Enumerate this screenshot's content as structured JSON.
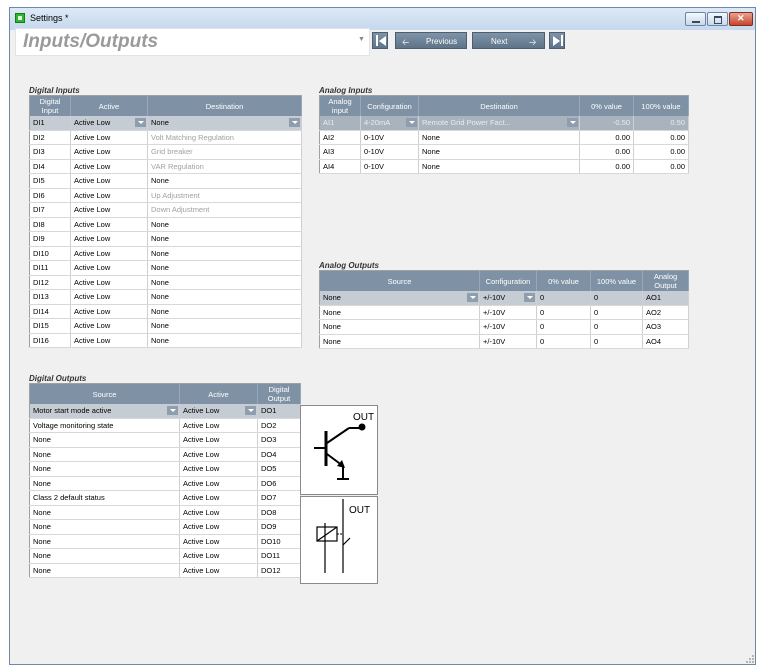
{
  "window": {
    "title": "Settings *"
  },
  "page": {
    "title": "Inputs/Outputs"
  },
  "nav": {
    "previous_label": "Previous",
    "next_label": "Next"
  },
  "digital_inputs": {
    "title": "Digital Inputs",
    "headers": [
      "Digital Input",
      "Active",
      "Destination"
    ],
    "rows": [
      {
        "input": "DI1",
        "active": "Active Low",
        "destination": "None",
        "selected": true
      },
      {
        "input": "DI2",
        "active": "Active Low",
        "destination": "Volt Matching Regulation",
        "grey": true
      },
      {
        "input": "DI3",
        "active": "Active Low",
        "destination": "Grid breaker",
        "grey": true
      },
      {
        "input": "DI4",
        "active": "Active Low",
        "destination": "VAR Regulation",
        "grey": true
      },
      {
        "input": "DI5",
        "active": "Active Low",
        "destination": "None"
      },
      {
        "input": "DI6",
        "active": "Active Low",
        "destination": "Up Adjustment",
        "grey": true
      },
      {
        "input": "DI7",
        "active": "Active Low",
        "destination": "Down Adjustment",
        "grey": true
      },
      {
        "input": "DI8",
        "active": "Active Low",
        "destination": "None"
      },
      {
        "input": "DI9",
        "active": "Active Low",
        "destination": "None"
      },
      {
        "input": "DI10",
        "active": "Active Low",
        "destination": "None"
      },
      {
        "input": "DI11",
        "active": "Active Low",
        "destination": "None"
      },
      {
        "input": "DI12",
        "active": "Active Low",
        "destination": "None"
      },
      {
        "input": "DI13",
        "active": "Active Low",
        "destination": "None"
      },
      {
        "input": "DI14",
        "active": "Active Low",
        "destination": "None"
      },
      {
        "input": "DI15",
        "active": "Active Low",
        "destination": "None"
      },
      {
        "input": "DI16",
        "active": "Active Low",
        "destination": "None"
      }
    ]
  },
  "analog_inputs": {
    "title": "Analog Inputs",
    "headers": [
      "Analog input",
      "Configuration",
      "Destination",
      "0% value",
      "100% value"
    ],
    "rows": [
      {
        "input": "AI1",
        "config": "4-20mA",
        "destination": "Remote Grid Power Fact...",
        "v0": "-0.50",
        "v100": "0.50",
        "dim": true
      },
      {
        "input": "AI2",
        "config": "0-10V",
        "destination": "None",
        "v0": "0.00",
        "v100": "0.00"
      },
      {
        "input": "AI3",
        "config": "0-10V",
        "destination": "None",
        "v0": "0.00",
        "v100": "0.00"
      },
      {
        "input": "AI4",
        "config": "0-10V",
        "destination": "None",
        "v0": "0.00",
        "v100": "0.00"
      }
    ]
  },
  "analog_outputs": {
    "title": "Analog Outputs",
    "headers": [
      "Source",
      "Configuration",
      "0% value",
      "100% value",
      "Analog Output"
    ],
    "rows": [
      {
        "source": "None",
        "config": "+/-10V",
        "v0": "0",
        "v100": "0",
        "output": "AO1",
        "selected": true
      },
      {
        "source": "None",
        "config": "+/-10V",
        "v0": "0",
        "v100": "0",
        "output": "AO2"
      },
      {
        "source": "None",
        "config": "+/-10V",
        "v0": "0",
        "v100": "0",
        "output": "AO3"
      },
      {
        "source": "None",
        "config": "+/-10V",
        "v0": "0",
        "v100": "0",
        "output": "AO4"
      }
    ]
  },
  "digital_outputs": {
    "title": "Digital Outputs",
    "headers": [
      "Source",
      "Active",
      "Digital Output"
    ],
    "rows": [
      {
        "source": "Motor start mode active",
        "active": "Active Low",
        "output": "DO1",
        "selected": true
      },
      {
        "source": "Voltage monitoring state",
        "active": "Active Low",
        "output": "DO2"
      },
      {
        "source": "None",
        "active": "Active Low",
        "output": "DO3"
      },
      {
        "source": "None",
        "active": "Active Low",
        "output": "DO4"
      },
      {
        "source": "None",
        "active": "Active Low",
        "output": "DO5"
      },
      {
        "source": "None",
        "active": "Active Low",
        "output": "DO6"
      },
      {
        "source": "Class 2 default status",
        "active": "Active Low",
        "output": "DO7"
      },
      {
        "source": "None",
        "active": "Active Low",
        "output": "DO8"
      },
      {
        "source": "None",
        "active": "Active Low",
        "output": "DO9"
      },
      {
        "source": "None",
        "active": "Active Low",
        "output": "DO10"
      },
      {
        "source": "None",
        "active": "Active Low",
        "output": "DO11"
      },
      {
        "source": "None",
        "active": "Active Low",
        "output": "DO12"
      }
    ],
    "transistor_label": "OUT",
    "relay_label": "OUT"
  }
}
